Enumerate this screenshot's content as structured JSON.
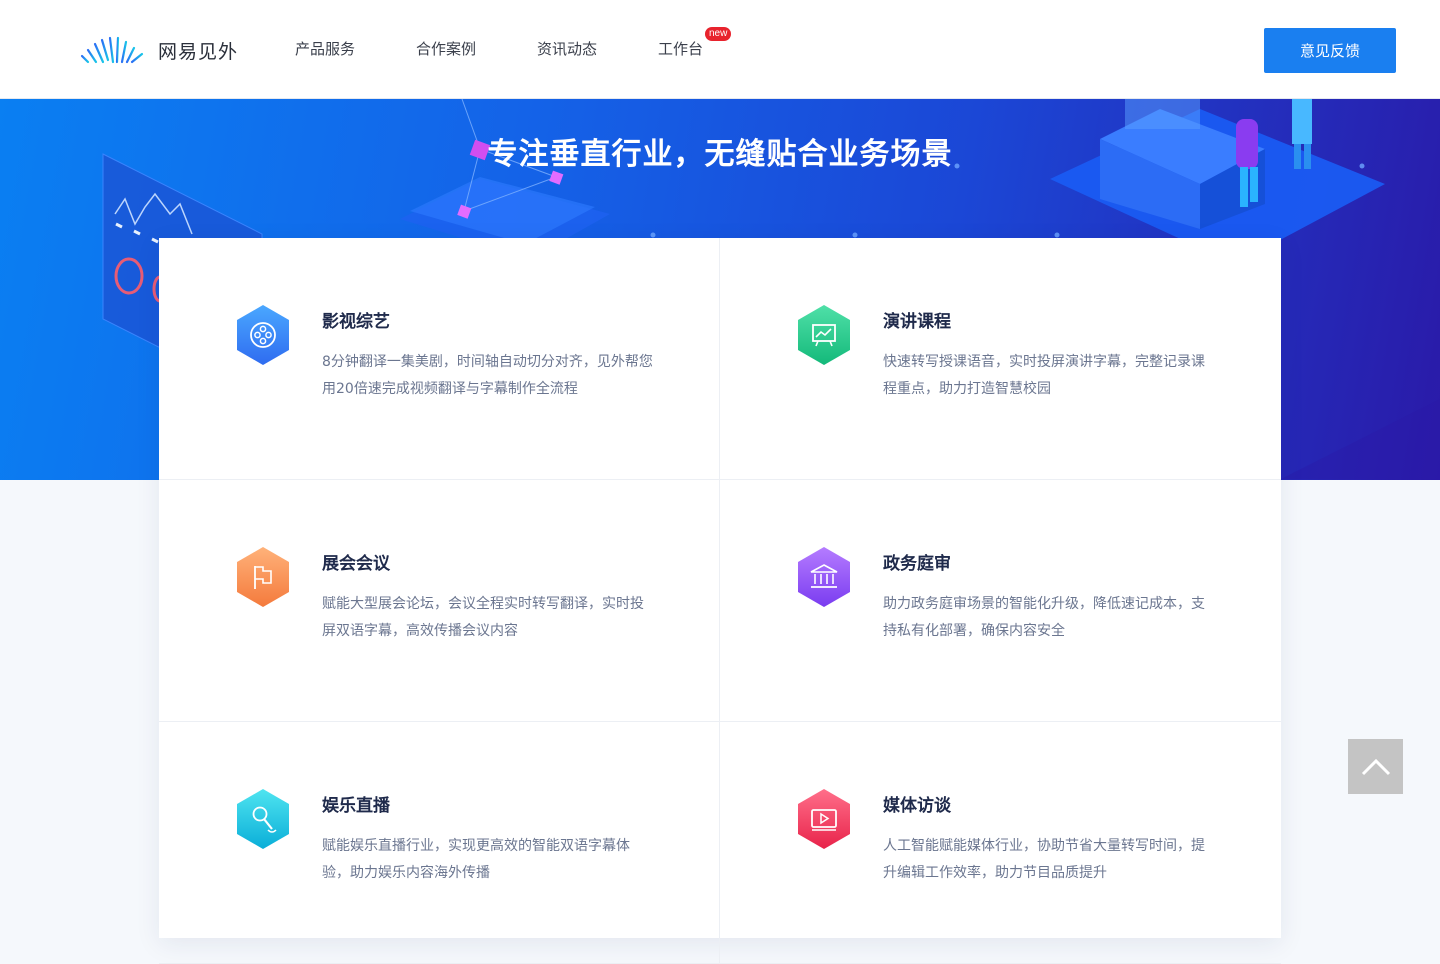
{
  "header": {
    "brand": "网易见外",
    "nav": [
      {
        "label": "产品服务"
      },
      {
        "label": "合作案例"
      },
      {
        "label": "资讯动态"
      },
      {
        "label": "工作台",
        "badge": "new"
      }
    ],
    "feedback_label": "意见反馈"
  },
  "hero": {
    "title": "专注垂直行业，无缝贴合业务场景"
  },
  "cards": [
    {
      "title": "影视综艺",
      "desc": "8分钟翻译一集美剧，时间轴自动切分对齐，见外帮您用20倍速完成视频翻译与字幕制作全流程",
      "icon": "film-reel-icon",
      "color_from": "#4aa8ff",
      "color_to": "#2f6cf0"
    },
    {
      "title": "演讲课程",
      "desc": "快速转写授课语音，实时投屏演讲字幕，完整记录课程重点，助力打造智慧校园",
      "icon": "presentation-board-icon",
      "color_from": "#4fe0a8",
      "color_to": "#14b97a"
    },
    {
      "title": "展会会议",
      "desc": "赋能大型展会论坛，会议全程实时转写翻译，实时投屏双语字幕，高效传播会议内容",
      "icon": "flag-icon",
      "color_from": "#ffb27a",
      "color_to": "#f47a3c"
    },
    {
      "title": "政务庭审",
      "desc": "助力政务庭审场景的智能化升级，降低速记成本，支持私有化部署，确保内容安全",
      "icon": "courthouse-icon",
      "color_from": "#b57cff",
      "color_to": "#7a3cf0"
    },
    {
      "title": "娱乐直播",
      "desc": "赋能娱乐直播行业，实现更高效的智能双语字幕体验，助力娱乐内容海外传播",
      "icon": "microphone-icon",
      "color_from": "#4fe4f0",
      "color_to": "#0aaed8"
    },
    {
      "title": "媒体访谈",
      "desc": "人工智能赋能媒体行业，协助节省大量转写时间，提升编辑工作效率，助力节目品质提升",
      "icon": "video-play-icon",
      "color_from": "#ff6f8a",
      "color_to": "#e8234a"
    }
  ],
  "back_to_top": {
    "icon": "chevron-up-icon"
  }
}
